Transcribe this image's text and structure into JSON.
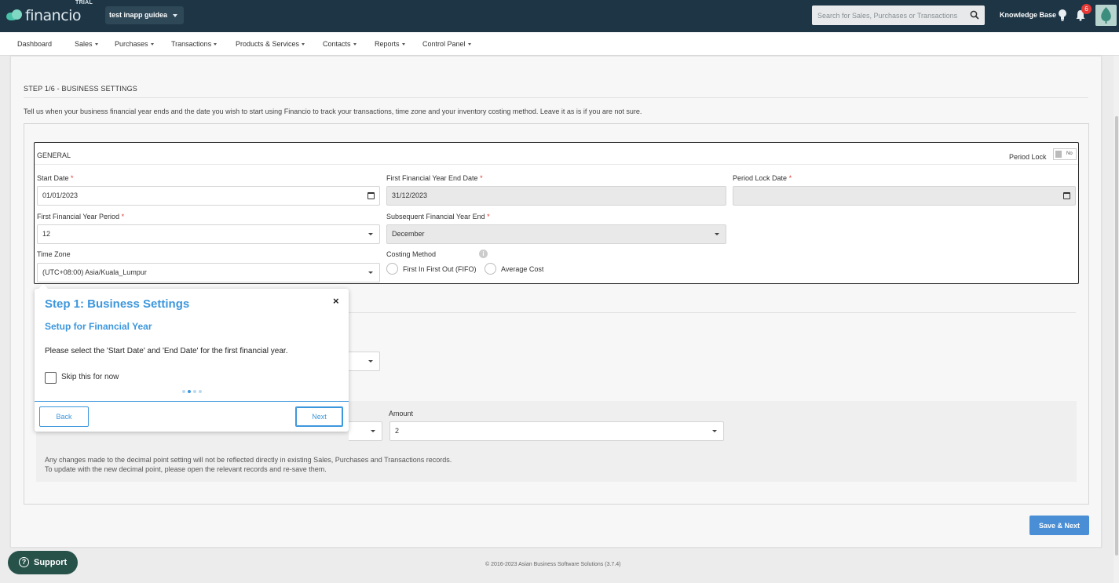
{
  "header": {
    "logo_text": "financio",
    "trial_label": "TRIAL",
    "company": "test inapp guidea",
    "search_placeholder": "Search for Sales, Purchases or Transactions",
    "knowledge_base": "Knowledge Base",
    "notification_count": "6"
  },
  "nav": {
    "items": [
      {
        "label": "Dashboard"
      },
      {
        "label": "Sales"
      },
      {
        "label": "Purchases"
      },
      {
        "label": "Transactions"
      },
      {
        "label": "Products & Services"
      },
      {
        "label": "Contacts"
      },
      {
        "label": "Reports"
      },
      {
        "label": "Control Panel"
      }
    ]
  },
  "page": {
    "step_title": "STEP 1/6 - BUSINESS SETTINGS",
    "description": "Tell us when your business financial year ends and the date you wish to start using Financio to track your transactions, time zone and your inventory costing method. Leave it as is if you are not sure."
  },
  "general": {
    "title": "GENERAL",
    "period_lock_label": "Period Lock",
    "period_lock_value": "No",
    "start_date_label": "Start Date",
    "start_date_value": "01/01/2023",
    "fy_end_label": "First Financial Year End Date",
    "fy_end_value": "31/12/2023",
    "period_lock_date_label": "Period Lock Date",
    "period_lock_date_value": "",
    "fy_period_label": "First Financial Year Period",
    "fy_period_value": "12",
    "subsequent_label": "Subsequent Financial Year End",
    "subsequent_value": "December",
    "timezone_label": "Time Zone",
    "timezone_value": "(UTC+08:00) Asia/Kuala_Lumpur",
    "costing_label": "Costing Method",
    "costing_options": [
      "First In First Out (FIFO)",
      "Average Cost"
    ],
    "required_mark": "*"
  },
  "decimal": {
    "amount_label": "Amount",
    "amount_value": "2",
    "note_line1": "Any changes made to the decimal point setting will not be reflected directly in existing Sales, Purchases and Transactions records.",
    "note_line2": "To update with the new decimal point, please open the relevant records and re-save them."
  },
  "actions": {
    "save_next": "Save & Next"
  },
  "guide": {
    "title": "Step 1: Business Settings",
    "subtitle": "Setup for Financial Year",
    "body": "Please select the 'Start Date' and 'End Date' for the first financial year.",
    "skip_label": "Skip this for now",
    "back": "Back",
    "next": "Next",
    "close": "×",
    "current_dot": 2,
    "total_dots": 4
  },
  "support": {
    "label": "Support"
  },
  "footer": {
    "copyright": "© 2016-2023 Asian Business Software Solutions (3.7.4)"
  },
  "colors": {
    "header_bg": "#1d3545",
    "accent": "#3d97dc",
    "save_button": "#4a8fd6",
    "support_bg": "#27524a",
    "badge": "#e53935"
  }
}
